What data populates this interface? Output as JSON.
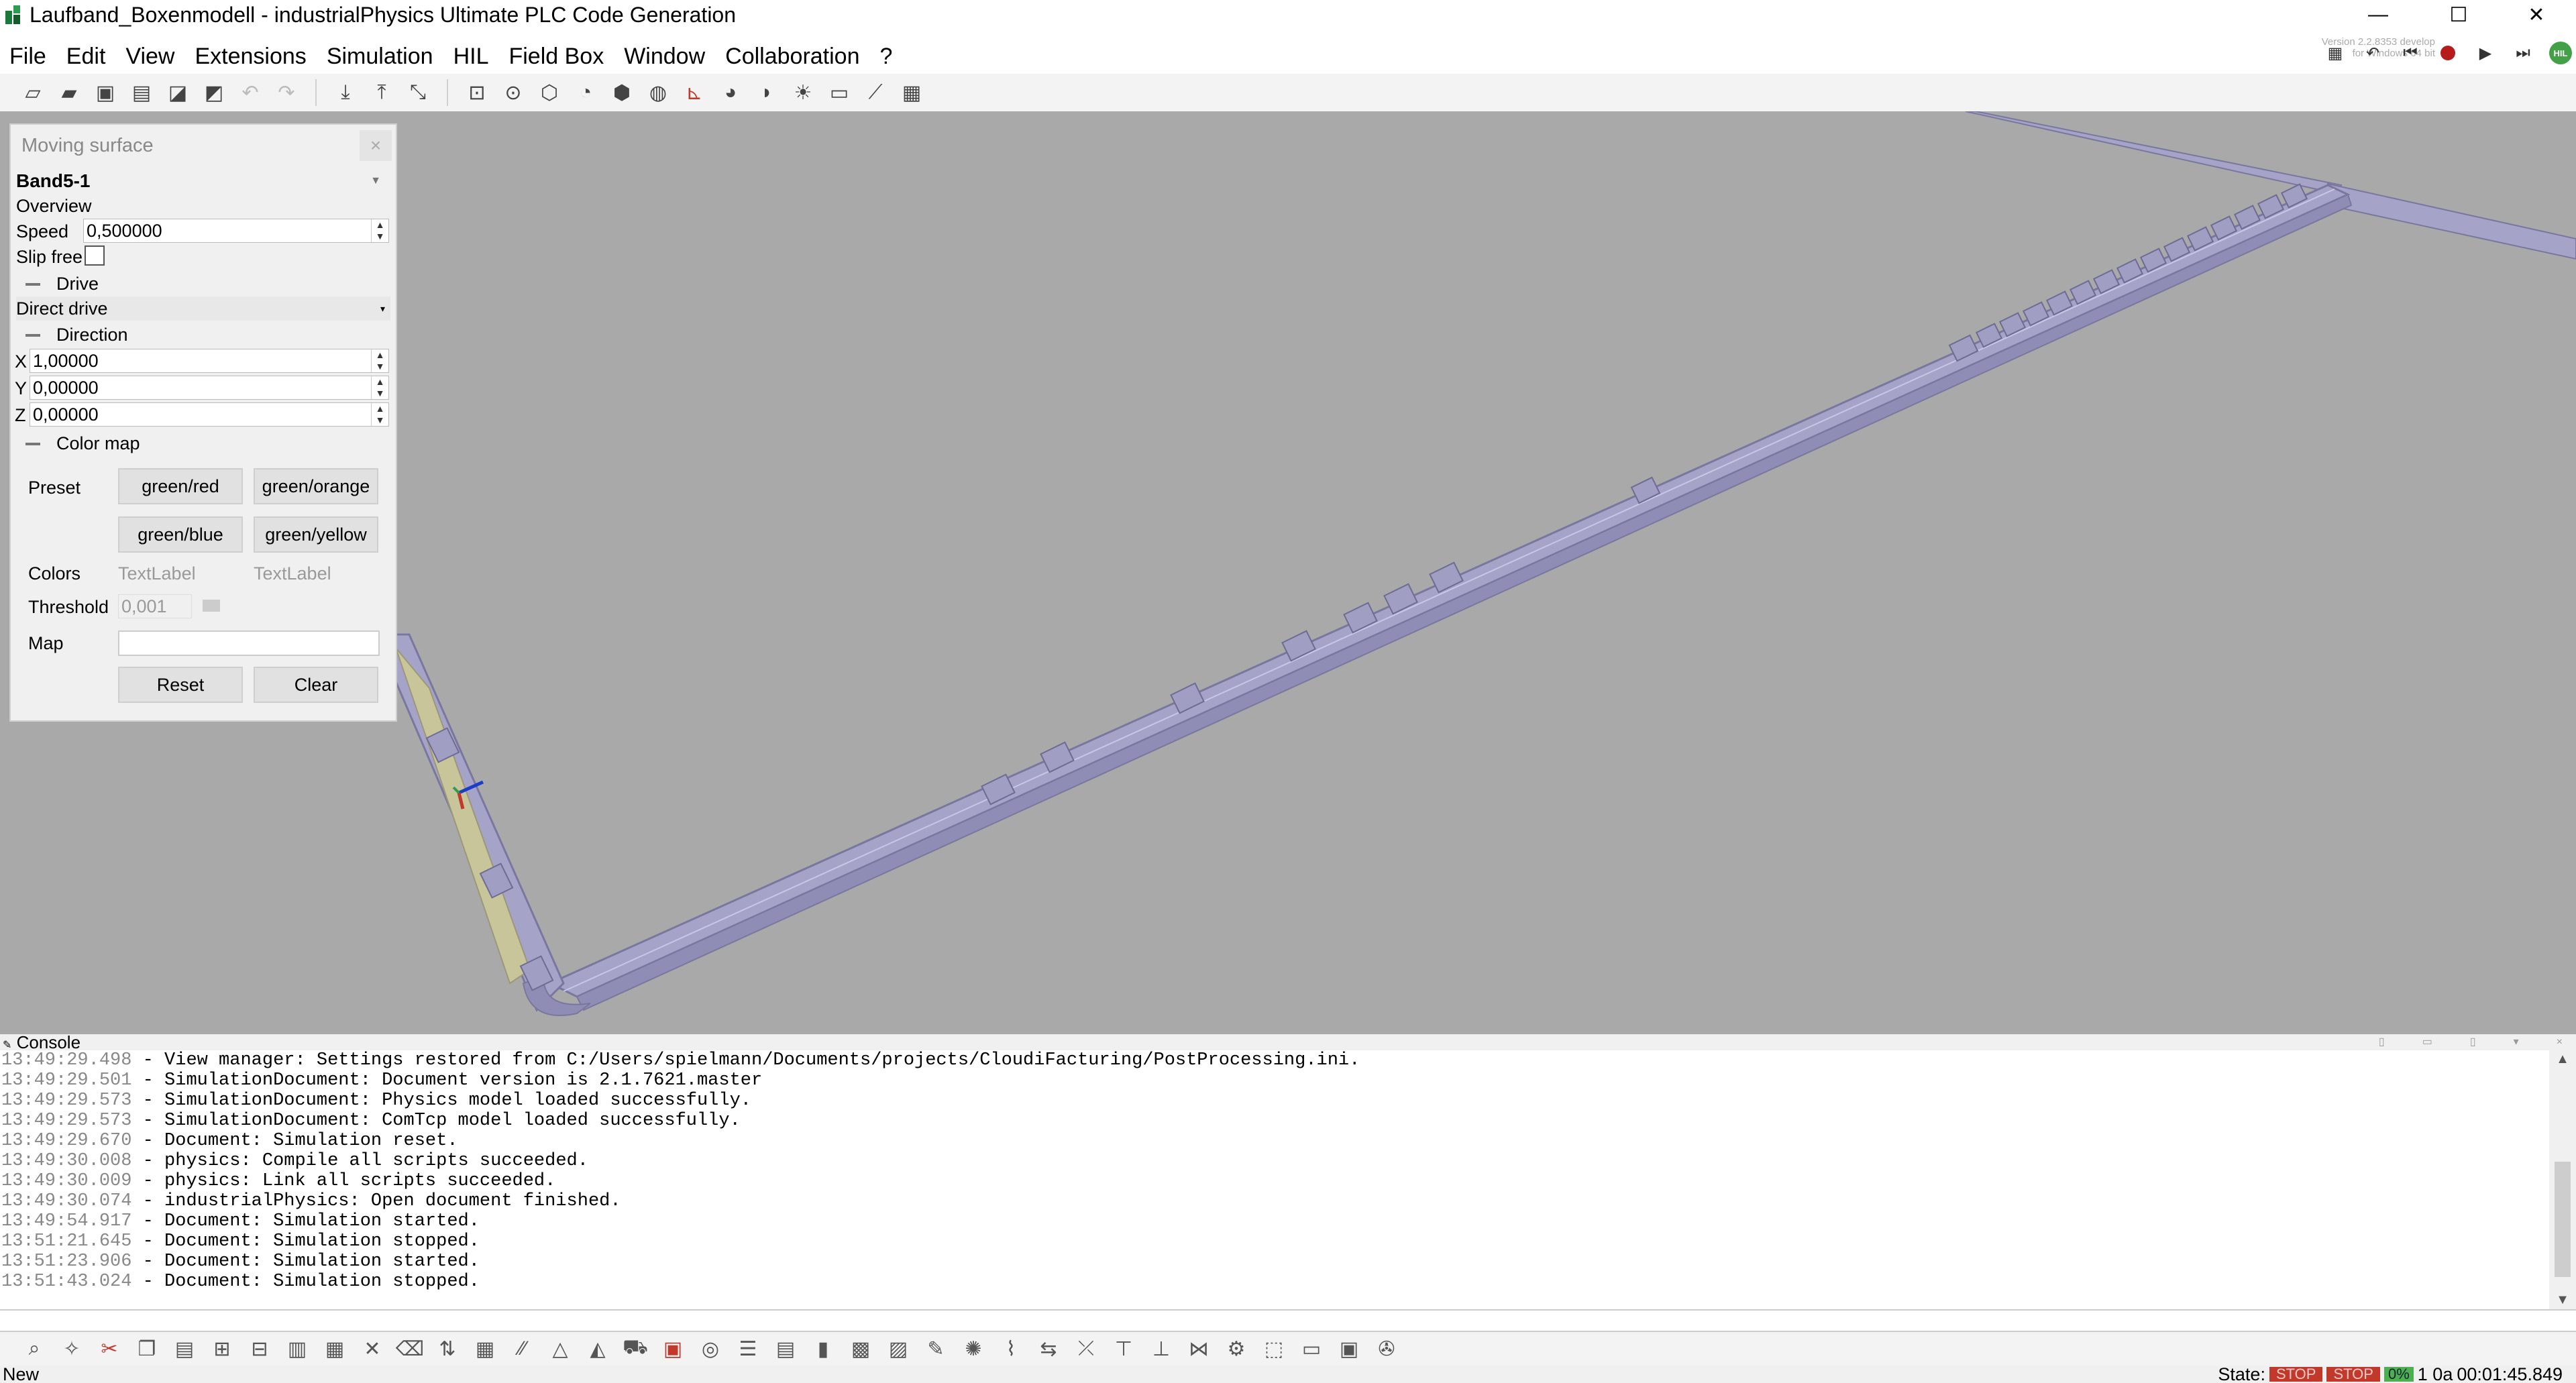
{
  "window": {
    "title": "Laufband_Boxenmodell - industrialPhysics Ultimate PLC Code Generation",
    "minimize": "—",
    "maximize": "☐",
    "close": "✕"
  },
  "menu": [
    "File",
    "Edit",
    "View",
    "Extensions",
    "Simulation",
    "HIL",
    "Field Box",
    "Window",
    "Collaboration",
    "?"
  ],
  "version": {
    "line1": "Version 2.2.8353 develop",
    "line2": "for Windows 64 bit"
  },
  "sim_controls": {
    "hil_label": "HIL"
  },
  "panel": {
    "title": "Moving surface",
    "close": "×",
    "object_name": "Band5-1",
    "overview_label": "Overview",
    "speed_label": "Speed",
    "speed_value": "0,500000",
    "slip_free_label": "Slip free",
    "drive_label": "Drive",
    "drive_value": "Direct drive",
    "direction_label": "Direction",
    "x_label": "X",
    "x_value": "1,00000",
    "y_label": "Y",
    "y_value": "0,00000",
    "z_label": "Z",
    "z_value": "0,00000",
    "color_map_label": "Color map",
    "preset_label": "Preset",
    "preset_buttons": [
      "green/red",
      "green/orange",
      "green/blue",
      "green/yellow"
    ],
    "colors_label": "Colors",
    "color_text_1": "TextLabel",
    "color_text_2": "TextLabel",
    "threshold_label": "Threshold",
    "threshold_value": "0,001",
    "map_label": "Map",
    "reset_label": "Reset",
    "clear_label": "Clear"
  },
  "console": {
    "tab_label": "Console",
    "lines": [
      {
        "time": "13:49:29.498",
        "msg": " - View manager: Settings restored from C:/Users/spielmann/Documents/projects/CloudiFacturing/PostProcessing.ini."
      },
      {
        "time": "13:49:29.501",
        "msg": " - SimulationDocument: Document version is 2.1.7621.master"
      },
      {
        "time": "13:49:29.573",
        "msg": " - SimulationDocument: Physics model loaded successfully."
      },
      {
        "time": "13:49:29.573",
        "msg": " - SimulationDocument: ComTcp model loaded successfully."
      },
      {
        "time": "13:49:29.670",
        "msg": " - Document: Simulation reset."
      },
      {
        "time": "13:49:30.008",
        "msg": " - physics: Compile all scripts succeeded."
      },
      {
        "time": "13:49:30.009",
        "msg": " - physics: Link all scripts succeeded."
      },
      {
        "time": "13:49:30.074",
        "msg": " - industrialPhysics: Open document finished."
      },
      {
        "time": "13:49:54.917",
        "msg": " - Document: Simulation started."
      },
      {
        "time": "13:51:21.645",
        "msg": " - Document: Simulation stopped."
      },
      {
        "time": "13:51:23.906",
        "msg": " - Document: Simulation started."
      },
      {
        "time": "13:51:43.024",
        "msg": " - Document: Simulation stopped."
      }
    ]
  },
  "status": {
    "left": "New",
    "state_label": "State:",
    "badge1": "STOP",
    "badge2": "STOP",
    "pct": "0%",
    "mid": "1 0a",
    "time": "00:01:45.849"
  },
  "colors": {
    "viewport_bg": "#a9a9a9",
    "conveyor": "#a6a3c9",
    "conveyor_edge": "#7a779e",
    "belt_zone": "#c9c59a",
    "record_red": "#b71c1c",
    "hil_green": "#43a047"
  }
}
